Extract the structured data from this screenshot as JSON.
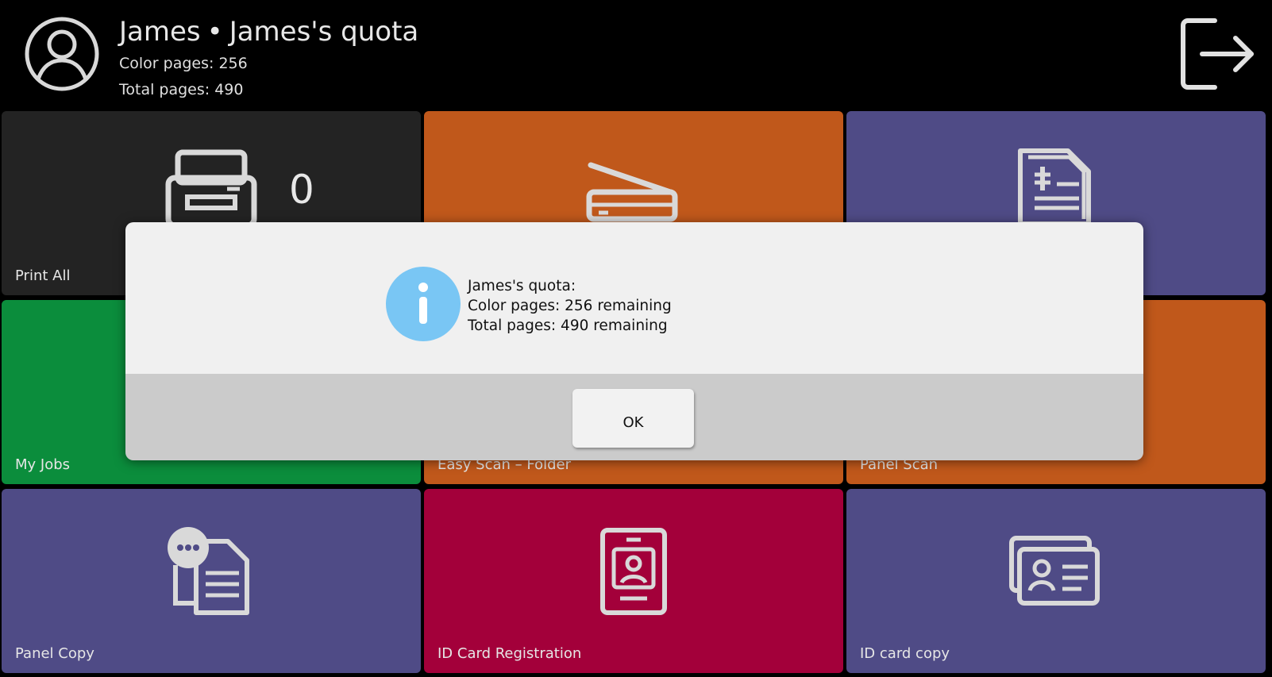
{
  "header": {
    "user_name": "James",
    "separator": "•",
    "quota_name": "James's quota",
    "color_pages": "Color pages: 256",
    "total_pages": "Total pages: 490",
    "avatar_icon": "user-avatar-icon",
    "logout_icon": "logout-icon"
  },
  "tiles": [
    {
      "label": "Print All",
      "color": "#232323",
      "icon": "printer-icon",
      "count": "0"
    },
    {
      "label": "",
      "color": "#c0581b",
      "icon": "scanner-icon"
    },
    {
      "label": "",
      "color": "#4f4b86",
      "icon": "fax-document-icon"
    },
    {
      "label": "My Jobs",
      "color": "#0b8d3c",
      "icon": ""
    },
    {
      "label": "Easy Scan – Folder",
      "color": "#c0581b",
      "icon": ""
    },
    {
      "label": "Panel Scan",
      "color": "#c0581b",
      "icon": ""
    },
    {
      "label": "Panel Copy",
      "color": "#4f4b86",
      "icon": "copy-documents-icon"
    },
    {
      "label": "ID Card Registration",
      "color": "#a3003a",
      "icon": "id-badge-icon"
    },
    {
      "label": "ID card copy",
      "color": "#4f4b86",
      "icon": "id-cards-icon"
    }
  ],
  "dialog": {
    "icon": "info-icon",
    "icon_color": "#79c6f4",
    "line1": "James's quota:",
    "line2": "Color pages: 256 remaining",
    "line3": "Total pages: 490 remaining",
    "ok_label": "OK"
  }
}
